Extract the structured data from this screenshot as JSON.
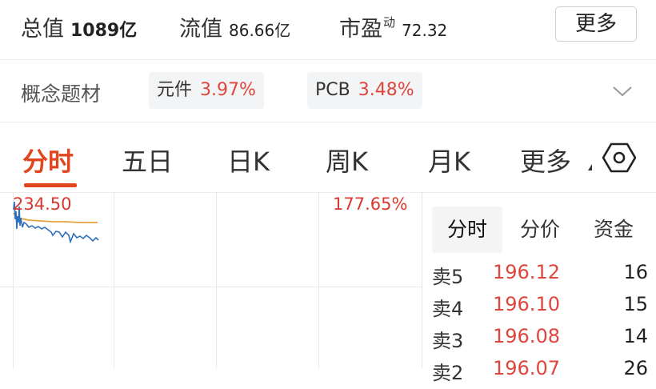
{
  "header": {
    "market_cap": {
      "label": "总值",
      "value": "1089亿"
    },
    "float_cap": {
      "label": "流值",
      "value": "86.66亿"
    },
    "pe": {
      "label": "市盈",
      "sup": "动",
      "value": "72.32"
    },
    "more_label": "更多"
  },
  "concepts": {
    "label": "概念题材",
    "items": [
      {
        "name": "元件",
        "pct": "3.97%"
      },
      {
        "name": "PCB",
        "pct": "3.48%"
      }
    ],
    "expand_icon": "chevron-down-icon"
  },
  "tabs": [
    {
      "label": "分时"
    },
    {
      "label": "五日"
    },
    {
      "label": "日K"
    },
    {
      "label": "周K"
    },
    {
      "label": "月K"
    },
    {
      "label": "更多"
    }
  ],
  "tab_active_index": 0,
  "settings_icon": "hexagon-settings-icon",
  "chart": {
    "price_high": "234.50",
    "pct_high": "177.65%",
    "colors": {
      "price_line": "#2f6fbf",
      "avg_line": "#e6a23c",
      "up": "#d9382f"
    }
  },
  "side_panel": {
    "tabs": [
      {
        "label": "分时"
      },
      {
        "label": "分价"
      },
      {
        "label": "资金"
      }
    ],
    "order_book": [
      {
        "label": "卖5",
        "price": "196.12",
        "volume": "16"
      },
      {
        "label": "卖4",
        "price": "196.10",
        "volume": "15"
      },
      {
        "label": "卖3",
        "price": "196.08",
        "volume": "14"
      },
      {
        "label": "卖2",
        "price": "196.07",
        "volume": "26"
      }
    ]
  }
}
